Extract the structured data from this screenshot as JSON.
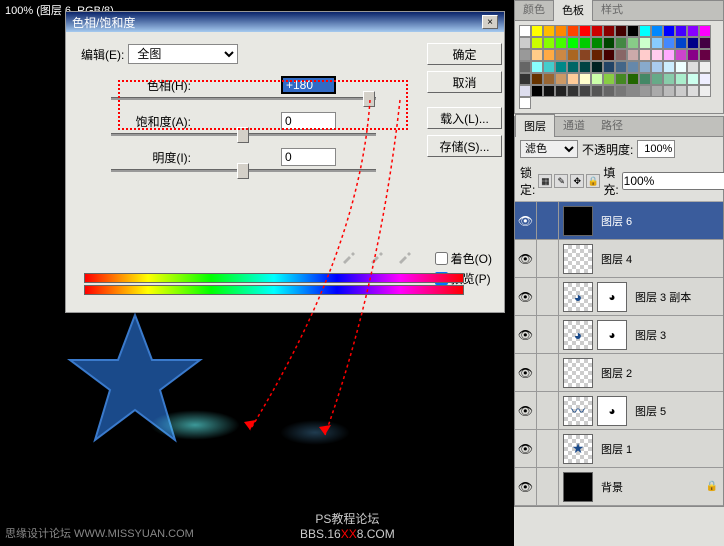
{
  "status_bar": "100%  (图层 6,  RGB/8)",
  "watermark_left": "思缘设计论坛  WWW.MISSYUAN.COM",
  "watermark_main": {
    "line1": "PS教程论坛",
    "line2_pre": "BBS.16",
    "line2_mid": "XX",
    "line2_post": "8.COM"
  },
  "dialog": {
    "title": "色相/饱和度",
    "close": "×",
    "edit_label": "编辑(E):",
    "edit_value": "全图",
    "sliders": {
      "hue": {
        "label": "色相(H):",
        "value": "+180"
      },
      "sat": {
        "label": "饱和度(A):",
        "value": "0"
      },
      "light": {
        "label": "明度(I):",
        "value": "0"
      }
    },
    "colorize": "着色(O)",
    "preview": "预览(P)",
    "buttons": {
      "ok": "确定",
      "cancel": "取消",
      "load": "载入(L)...",
      "save": "存储(S)..."
    }
  },
  "panels": {
    "color_tabs": [
      "颜色",
      "色板",
      "样式"
    ],
    "layer_tabs": [
      "图层",
      "通道",
      "路径"
    ],
    "blend_mode": "滤色",
    "opacity_label": "不透明度:",
    "opacity_value": "100%",
    "lock_label": "锁定:",
    "fill_label": "填充:",
    "fill_value": "100%",
    "layers": [
      {
        "name": "图层 6",
        "active": true,
        "mask": false
      },
      {
        "name": "图层 4",
        "active": false,
        "mask": false
      },
      {
        "name": "图层 3 副本",
        "active": false,
        "mask": true
      },
      {
        "name": "图层 3",
        "active": false,
        "mask": true
      },
      {
        "name": "图层 2",
        "active": false,
        "mask": false
      },
      {
        "name": "图层 5",
        "active": false,
        "mask": true
      },
      {
        "name": "图层 1",
        "active": false,
        "mask": false
      },
      {
        "name": "背景",
        "active": false,
        "mask": false,
        "locked": true
      }
    ]
  },
  "swatch_colors": [
    "#fff",
    "#ff0",
    "#fb0",
    "#f80",
    "#f40",
    "#f00",
    "#c00",
    "#800",
    "#400",
    "#000",
    "#0ff",
    "#08f",
    "#00f",
    "#40f",
    "#80f",
    "#f0f",
    "#ccc",
    "#cf0",
    "#8f0",
    "#4f0",
    "#0f0",
    "#0c0",
    "#080",
    "#040",
    "#484",
    "#8c8",
    "#cfc",
    "#8cf",
    "#48f",
    "#04c",
    "#008",
    "#404",
    "#999",
    "#fc8",
    "#fa4",
    "#c84",
    "#a62",
    "#842",
    "#620",
    "#400",
    "#866",
    "#caa",
    "#fcc",
    "#fce",
    "#faf",
    "#c4c",
    "#808",
    "#604",
    "#666",
    "#8ff",
    "#4cc",
    "#088",
    "#066",
    "#044",
    "#022",
    "#246",
    "#468",
    "#68a",
    "#8ac",
    "#ace",
    "#cef",
    "#eff",
    "#ddd",
    "#eee",
    "#333",
    "#630",
    "#963",
    "#c96",
    "#fc9",
    "#ffc",
    "#cfa",
    "#8c4",
    "#482",
    "#260",
    "#486",
    "#6a8",
    "#8ca",
    "#aec",
    "#cfe",
    "#eef",
    "#dde",
    "#000",
    "#111",
    "#222",
    "#333",
    "#444",
    "#555",
    "#666",
    "#777",
    "#888",
    "#999",
    "#aaa",
    "#bbb",
    "#ccc",
    "#ddd",
    "#eee",
    "#fff"
  ]
}
